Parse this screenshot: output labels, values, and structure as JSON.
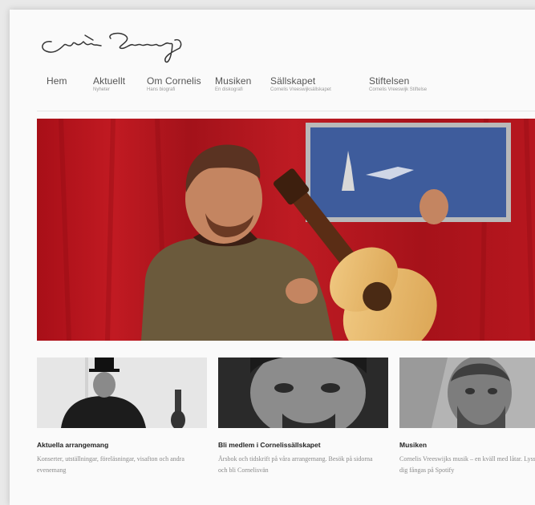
{
  "header": {
    "logo_alt": "Cornelis Vreeswijk signature logo"
  },
  "nav": {
    "items": [
      {
        "label": "Hem",
        "sub": ""
      },
      {
        "label": "Aktuellt",
        "sub": "Nyheter"
      },
      {
        "label": "Om Cornelis",
        "sub": "Hans biografi"
      },
      {
        "label": "Musiken",
        "sub": "En diskografi"
      },
      {
        "label": "Sällskapet",
        "sub": "Cornelis Vreeswijksällskapet"
      },
      {
        "label": "Stiftelsen",
        "sub": "Cornelis Vreeswijk Stiftelse"
      }
    ]
  },
  "hero": {
    "image": "Man with red curtain backdrop playing classical guitar"
  },
  "cards": [
    {
      "title": "Aktuella arrangemang",
      "text": "Konserter, utställningar, föreläsningar, visafton och andra evenemang"
    },
    {
      "title": "Bli medlem i Cornelissällskapet",
      "text": "Årsbok och tidskrift på våra arrangemang. Besök på sidorna och bli Cornelisvän"
    },
    {
      "title": "Musiken",
      "text": "Cornelis Vreeswijks musik – en kväll med låtar. Lyssna och låt dig fångas på Spotify"
    }
  ],
  "colors": {
    "accent_red": "#b5131c",
    "page_bg": "#fafafa",
    "nav_text": "#555555"
  }
}
